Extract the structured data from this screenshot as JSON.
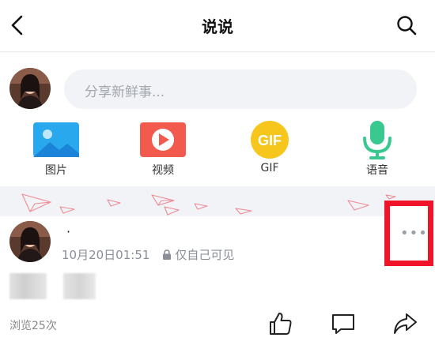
{
  "header": {
    "title": "说说",
    "back_icon": "chevron-left-icon",
    "search_icon": "search-icon"
  },
  "composer": {
    "placeholder": "分享新鲜事..."
  },
  "tools": [
    {
      "label": "图片",
      "icon": "image-icon",
      "color": "#29a8ee"
    },
    {
      "label": "视频",
      "icon": "video-play-icon",
      "color": "#f25a4d"
    },
    {
      "label": "GIF",
      "icon": "gif-icon",
      "color": "#f7c61c"
    },
    {
      "label": "语音",
      "icon": "microphone-icon",
      "color": "#39c88f"
    }
  ],
  "post": {
    "author": "·",
    "time": "10月20日01:51",
    "privacy": "仅自己可见",
    "privacy_icon": "lock-icon",
    "more_icon": "more-dots-icon",
    "highlight_color": "#f0142a",
    "views": "浏览25次",
    "actions": [
      "thumbs-up-icon",
      "comment-icon",
      "share-icon"
    ]
  },
  "colors": {
    "accent_red": "#f0142a",
    "muted_text": "#8a8f97"
  }
}
